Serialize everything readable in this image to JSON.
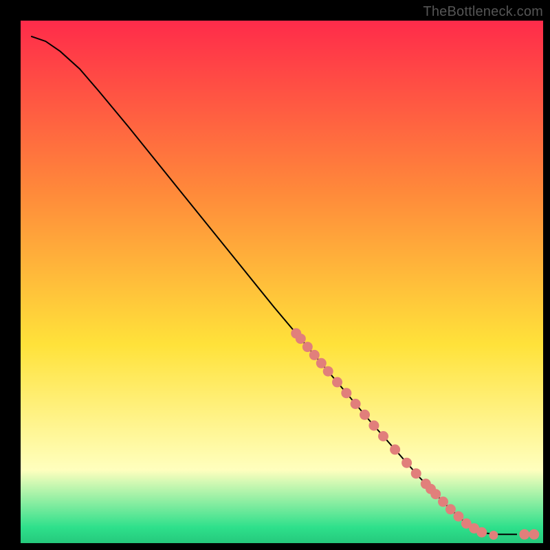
{
  "watermark": "TheBottleneck.com",
  "colors": {
    "bg": "#000000",
    "curve": "#000000",
    "marker_fill": "#e17f7b",
    "marker_stroke": "#b85a56",
    "gradient_top": "#ff2b4a",
    "gradient_mid1": "#ff8a3a",
    "gradient_mid2": "#ffe23a",
    "gradient_band": "#ffffbe",
    "gradient_green": "#2ee08b"
  },
  "chart_data": {
    "type": "line",
    "title": "",
    "xlabel": "",
    "ylabel": "",
    "xlim": [
      0,
      100
    ],
    "ylim": [
      0,
      100
    ],
    "curve": [
      {
        "x": 0,
        "y": 100
      },
      {
        "x": 3,
        "y": 99
      },
      {
        "x": 6,
        "y": 97
      },
      {
        "x": 10,
        "y": 93.5
      },
      {
        "x": 14,
        "y": 89
      },
      {
        "x": 20,
        "y": 82
      },
      {
        "x": 30,
        "y": 70
      },
      {
        "x": 40,
        "y": 58
      },
      {
        "x": 50,
        "y": 46
      },
      {
        "x": 60,
        "y": 34.5
      },
      {
        "x": 70,
        "y": 23
      },
      {
        "x": 80,
        "y": 12
      },
      {
        "x": 86,
        "y": 6
      },
      {
        "x": 90,
        "y": 2.5
      },
      {
        "x": 93,
        "y": 1
      },
      {
        "x": 96,
        "y": 0.7
      },
      {
        "x": 100,
        "y": 0.7
      }
    ],
    "markers": [
      {
        "x": 70.0,
        "y": 42.0
      },
      {
        "x": 71.0,
        "y": 40.7
      },
      {
        "x": 72.2,
        "y": 39.2
      },
      {
        "x": 73.3,
        "y": 37.8
      },
      {
        "x": 74.4,
        "y": 36.4
      },
      {
        "x": 75.5,
        "y": 35.0
      },
      {
        "x": 77.0,
        "y": 33.1
      },
      {
        "x": 78.5,
        "y": 31.2
      },
      {
        "x": 80.0,
        "y": 29.2
      },
      {
        "x": 81.3,
        "y": 27.6
      },
      {
        "x": 82.6,
        "y": 25.9
      },
      {
        "x": 84.0,
        "y": 24.2
      },
      {
        "x": 86.0,
        "y": 21.6
      },
      {
        "x": 88.0,
        "y": 19.0
      },
      {
        "x": 89.5,
        "y": 16.9
      },
      {
        "x": 91.0,
        "y": 14.8
      },
      {
        "x": 91.8,
        "y": 13.7
      },
      {
        "x": 92.6,
        "y": 12.5
      },
      {
        "x": 93.8,
        "y": 10.7
      },
      {
        "x": 95.0,
        "y": 9.0
      },
      {
        "x": 96.2,
        "y": 7.0
      },
      {
        "x": 97.4,
        "y": 5.0
      },
      {
        "x": 98.3,
        "y": 3.5
      },
      {
        "x": 99.0,
        "y": 2.3
      },
      {
        "x": 100.5,
        "y": 1.0
      },
      {
        "x": 104.0,
        "y": 0.9
      },
      {
        "x": 105.2,
        "y": 0.9
      }
    ]
  }
}
